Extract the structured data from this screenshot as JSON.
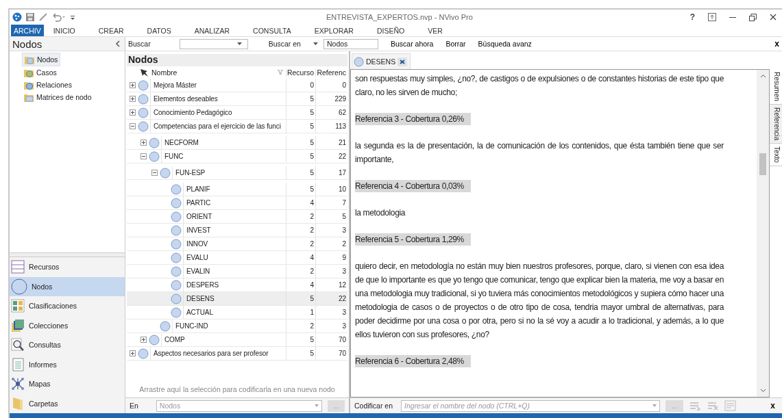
{
  "window": {
    "title": "ENTREVISTA_EXPERTOS.nvp - NVivo Pro",
    "help": "?"
  },
  "menu": [
    {
      "label": "ARCHIV",
      "selected": true
    },
    {
      "label": "INICIO",
      "selected": false
    },
    {
      "label": "CREAR",
      "selected": false
    },
    {
      "label": "DATOS",
      "selected": false
    },
    {
      "label": "ANALIZAR",
      "selected": false
    },
    {
      "label": "CONSULTA",
      "selected": false
    },
    {
      "label": "EXPLORAR",
      "selected": false
    },
    {
      "label": "DISEÑO",
      "selected": false
    },
    {
      "label": "VER",
      "selected": false
    }
  ],
  "navigation": {
    "title": "Nodos",
    "folders": [
      {
        "label": "Nodos",
        "selected": true
      },
      {
        "label": "Casos",
        "selected": false
      },
      {
        "label": "Relaciones",
        "selected": false
      },
      {
        "label": "Matrices de nodo",
        "selected": false
      }
    ],
    "sections": [
      {
        "label": "Recursos",
        "selected": false
      },
      {
        "label": "Nodos",
        "selected": true
      },
      {
        "label": "Clasificaciones",
        "selected": false
      },
      {
        "label": "Colecciones",
        "selected": false
      },
      {
        "label": "Consultas",
        "selected": false
      },
      {
        "label": "Informes",
        "selected": false
      },
      {
        "label": "Mapas",
        "selected": false
      },
      {
        "label": "Carpetas",
        "selected": false
      }
    ]
  },
  "search_bar": {
    "label": "Buscar",
    "search_in_label": "Buscar en",
    "search_in_value": "Nodos",
    "buttons": [
      "Buscar ahora",
      "Borrar",
      "Búsqueda avanz"
    ],
    "close": "x"
  },
  "node_list": {
    "title": "Nodos",
    "columns": [
      "Nombre",
      "Recurso",
      "Referenc"
    ],
    "nodes": [
      {
        "name": "Mejora Máster",
        "sources": "0",
        "references": "0",
        "expanded": false,
        "selected": false
      },
      {
        "name": "Elementos deseables",
        "sources": "5",
        "references": "229",
        "expanded": false,
        "selected": false
      },
      {
        "name": "Conocimiento Pedagógico",
        "sources": "5",
        "references": "62",
        "expanded": false,
        "selected": false
      },
      {
        "name": "Competencias para el ejercicio de las funci",
        "sources": "5",
        "references": "113",
        "expanded": true,
        "selected": false,
        "children": [
          {
            "name": "NECFORM",
            "sources": "5",
            "references": "21",
            "expanded": false,
            "selected": false
          },
          {
            "name": "FUNC",
            "sources": "5",
            "references": "22",
            "expanded": true,
            "selected": false,
            "children": [
              {
                "name": "FUN-ESP",
                "sources": "5",
                "references": "17",
                "expanded": true,
                "selected": false,
                "children": [
                  {
                    "name": "PLANIF",
                    "sources": "5",
                    "references": "10",
                    "selected": false
                  },
                  {
                    "name": "PARTIC",
                    "sources": "4",
                    "references": "7",
                    "selected": false
                  },
                  {
                    "name": "ORIENT",
                    "sources": "2",
                    "references": "5",
                    "selected": false
                  },
                  {
                    "name": "INVEST",
                    "sources": "2",
                    "references": "3",
                    "selected": false
                  },
                  {
                    "name": "INNOV",
                    "sources": "2",
                    "references": "2",
                    "selected": false
                  },
                  {
                    "name": "EVALU",
                    "sources": "4",
                    "references": "9",
                    "selected": false
                  },
                  {
                    "name": "EVALIN",
                    "sources": "2",
                    "references": "3",
                    "selected": false
                  },
                  {
                    "name": "DESPERS",
                    "sources": "4",
                    "references": "12",
                    "selected": false
                  },
                  {
                    "name": "DESENS",
                    "sources": "5",
                    "references": "22",
                    "selected": true
                  },
                  {
                    "name": "ACTUAL",
                    "sources": "1",
                    "references": "3",
                    "selected": false
                  }
                ]
              },
              {
                "name": "FUNC-IND",
                "sources": "2",
                "references": "3",
                "selected": false
              }
            ]
          },
          {
            "name": "COMP",
            "sources": "5",
            "references": "70",
            "expanded": false,
            "selected": false
          }
        ]
      },
      {
        "name": "Aspectos necesarios para ser profesor",
        "sources": "5",
        "references": "70",
        "expanded": false,
        "selected": false
      }
    ],
    "drop_hint": "Arrastre aquí la selección para codificarla en una nueva nodo",
    "in_label": "En",
    "in_value": "Nodos",
    "more": "..."
  },
  "document": {
    "tab": {
      "label": "DESENS"
    },
    "paragraphs": [
      {
        "kind": "text",
        "text": "son respuestas muy simples, ¿no?, de castigos o de expulsiones o de constantes historias de este tipo que claro, no les sirven de mucho;"
      },
      {
        "kind": "reference",
        "text": "Referencia 3 - Cobertura 0,26%"
      },
      {
        "kind": "text",
        "text": " la segunda es la de presentación, la de comunicación de los contenidos, que ésta también tiene que ser importante,"
      },
      {
        "kind": "reference",
        "text": "Referencia 4 - Cobertura 0,03%"
      },
      {
        "kind": "text",
        "text": "la metodologia"
      },
      {
        "kind": "reference",
        "text": "Referencia 5 - Cobertura 1,29%"
      },
      {
        "kind": "text",
        "text": "quiero decir, en metodología no están muy bien nuestros profesores, porque, claro, si vienen con esa idea de que lo importante es que yo tengo que comunicar, tengo que explicar bien la materia, me voy a basar en una metodologia muy tradicional, si yo tuviera más conocimientos metodológicos y supiera cómo hacer una metodologia de casos o de proyectos o de otro tipo de cosa, tendria mayor umbral de alternativas, para poder decidirme por una cosa o por otra, pero si no la sé voy a acudir a lo tradicional, y además, a lo que ellos tuvieron con sus profesores, ¿no?"
      },
      {
        "kind": "reference",
        "text": "Referencia 6 - Cobertura 2,48%"
      }
    ],
    "side_tabs": [
      {
        "label": "Resumen",
        "selected": false
      },
      {
        "label": "Referencia",
        "selected": true
      },
      {
        "label": "Texto",
        "selected": false
      }
    ],
    "code_label": "Codificar en",
    "code_placeholder": "Ingresar el nombre del nodo (CTRL+Q)",
    "more": "...",
    "close": "x"
  }
}
